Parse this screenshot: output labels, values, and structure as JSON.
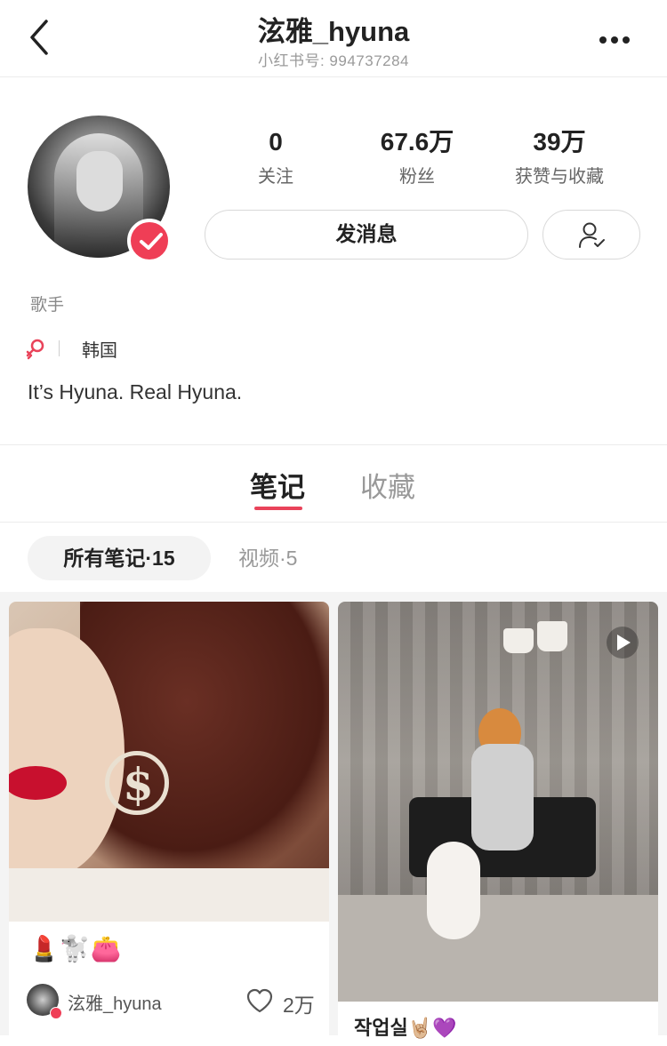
{
  "nav": {
    "title": "泫雅_hyuna",
    "subtitle": "小红书号: 994737284"
  },
  "profile": {
    "stats": [
      {
        "value": "0",
        "label": "关注"
      },
      {
        "value": "67.6万",
        "label": "粉丝"
      },
      {
        "value": "39万",
        "label": "获赞与收藏"
      }
    ],
    "message_button": "发消息",
    "occupation": "歌手",
    "location": "韩国",
    "bio": "It’s Hyuna. Real Hyuna."
  },
  "tabs": [
    {
      "label": "笔记",
      "active": true
    },
    {
      "label": "收藏",
      "active": false
    }
  ],
  "filters": {
    "active": "所有笔记·15",
    "other": "视频·5"
  },
  "cards": [
    {
      "emojis": "💄🐩👛",
      "author": "泫雅_hyuna",
      "likes": "2万"
    },
    {
      "title": "작업실🤘🏼💜",
      "is_video": true
    }
  ],
  "colors": {
    "accent": "#e9435a",
    "badge": "#ef3e56"
  }
}
